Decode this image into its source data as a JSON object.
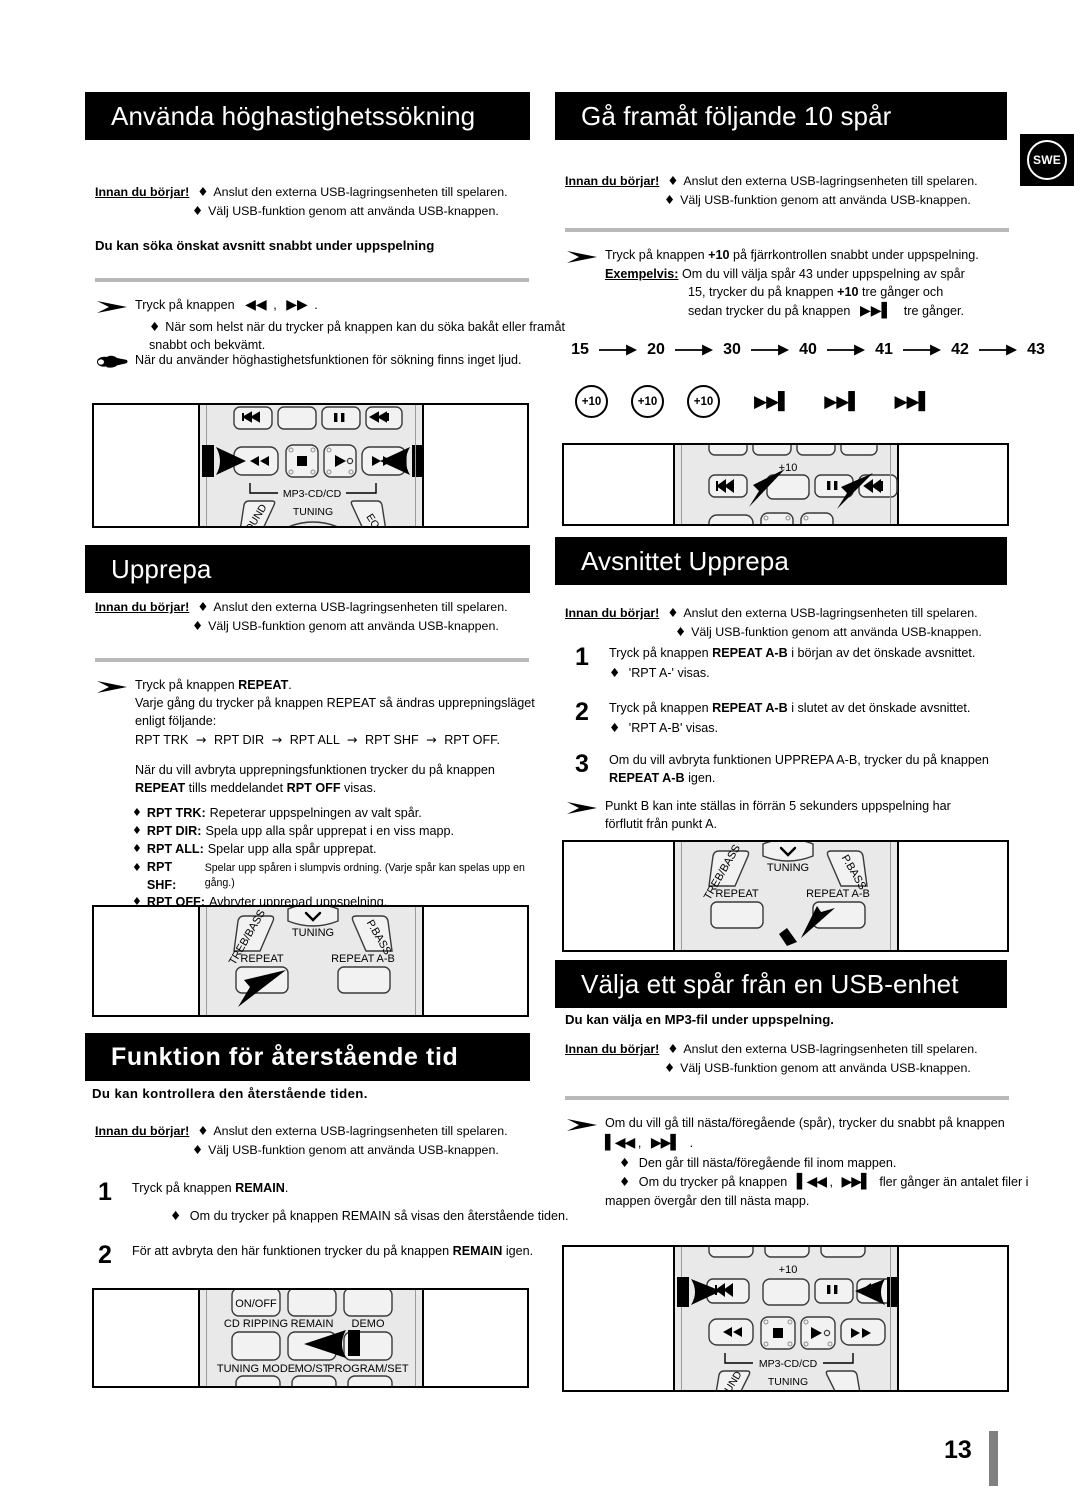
{
  "page": {
    "number": "13",
    "language_badge": "SWE"
  },
  "common": {
    "innan_label": "Innan du börjar!",
    "innan_line1": "Anslut den externa USB-lagringsenheten till spelaren.",
    "innan_line2": "Välj USB-funktion genom att använda USB-knappen.",
    "diamond": "♦",
    "arrow": "→"
  },
  "sections": {
    "hogastighetssokning": {
      "title": "Använda höghastighetssökning",
      "subtitle": "Du kan söka önskat avsnitt snabbt under uppspelning",
      "instruction_pre": "Tryck på knappen",
      "instruction_mid": ",",
      "instruction_post": ".",
      "bullet1": "När som helst när du trycker på knappen kan du söka bakåt eller framåt snabbt och bekvämt.",
      "note": "När du använder höghastighetsfunktionen för sökning finns inget ljud.",
      "remote": {
        "label_mp3": "MP3-CD/CD",
        "label_tuning": "TUNING",
        "label_sound": "SOUND",
        "label_eq": "EQ"
      }
    },
    "ga_framat": {
      "title": "Gå framåt följande 10 spår",
      "instruction": "Tryck på knappen +10 på fjärrkontrollen snabbt under uppspelning.",
      "instruction_btn": "+10",
      "instruction_a": "Tryck på knappen",
      "instruction_b": "på fjärrkontrollen snabbt under uppspelning.",
      "example_label": "Exempelvis:",
      "example_l1": "Om du vill välja spår 43 under uppspelning av spår",
      "example_l2a": "15, trycker du på knappen",
      "example_l2b": "+10",
      "example_l2c": "tre gånger och",
      "example_l3a": "sedan trycker du på knappen",
      "example_l3c": "tre gånger.",
      "sequence": [
        "15",
        "20",
        "30",
        "40",
        "41",
        "42",
        "43"
      ],
      "buttons": [
        "+10",
        "+10",
        "+10",
        "skip-next",
        "skip-next",
        "skip-next"
      ],
      "plus_ten": "+10",
      "remote": {
        "label_plus10": "+10"
      }
    },
    "upprepa": {
      "title": "Upprepa",
      "instruction_a": "Tryck på knappen",
      "instruction_btn": "REPEAT",
      "instruction_post": ".",
      "body_l1": "Varje gång du trycker på knappen REPEAT så ändras upprepningsläget",
      "body_l2": "enligt följande:",
      "cycle": [
        "RPT TRK",
        "RPT DIR",
        "RPT ALL",
        "RPT SHF",
        "RPT OFF."
      ],
      "cancel_l1": "När du vill avbryta upprepningsfunktionen trycker du på knappen",
      "cancel_l2a": "REPEAT",
      "cancel_l2b": "tills meddelandet",
      "cancel_l2c": "RPT OFF",
      "cancel_l2d": "visas.",
      "modes": [
        {
          "name": "RPT TRK:",
          "desc": "Repeterar uppspelningen av valt spår.",
          "small": false
        },
        {
          "name": "RPT DIR:",
          "desc": "Spela upp alla spår upprepat i en viss mapp.",
          "small": false
        },
        {
          "name": "RPT ALL:",
          "desc": "Spelar upp alla spår upprepat.",
          "small": false
        },
        {
          "name": "RPT SHF:",
          "desc": "Spelar upp spåren i slumpvis ordning. (Varje spår kan spelas upp en gång.)",
          "small": true
        },
        {
          "name": "RPT OFF:",
          "desc": "Avbryter upprepad uppspelning.",
          "small": false
        }
      ],
      "remote": {
        "treb_bass": "TREB/BASS",
        "tuning": "TUNING",
        "pbass": "P.BASS",
        "repeat": "REPEAT",
        "repeat_ab": "REPEAT A-B"
      }
    },
    "avsnittet_upprepa": {
      "title": "Avsnittet Upprepa",
      "steps": [
        {
          "num": "1",
          "line_a": "Tryck på knappen",
          "btn": "REPEAT A-B",
          "line_b": "i början av det önskade avsnittet.",
          "bullet": "'RPT A-' visas."
        },
        {
          "num": "2",
          "line_a": "Tryck på knappen",
          "btn": "REPEAT A-B",
          "line_b": "i slutet av det önskade avsnittet.",
          "bullet": "'RPT A-B' visas."
        },
        {
          "num": "3",
          "line_a": "Om du vill avbryta funktionen UPPREPA A-B, trycker du på knappen",
          "btn": "REPEAT A-B",
          "line_b": "igen.",
          "bullet": ""
        }
      ],
      "note_l1": "Punkt B kan inte ställas in förrän 5 sekunders uppspelning har",
      "note_l2": "förflutit från punkt A.",
      "remote": {
        "treb_bass": "TREB/BASS",
        "tuning": "TUNING",
        "pbass": "P.BASS",
        "repeat": "REPEAT",
        "repeat_ab": "REPEAT A-B"
      }
    },
    "aterstaende_tid": {
      "title": "Funktion för återstående tid",
      "subtitle": "Du kan kontrollera den återstående tiden.",
      "steps": [
        {
          "num": "1",
          "line_a": "Tryck på knappen",
          "btn": "REMAIN",
          "line_b": ".",
          "bullet": "Om du trycker på knappen REMAIN så visas den återstående tiden."
        },
        {
          "num": "2",
          "line_a": "För att avbryta den här funktionen trycker du på knappen",
          "btn": "REMAIN",
          "line_b": "igen.",
          "bullet": ""
        }
      ],
      "remote": {
        "onoff": "ON/OFF",
        "cd_ripping": "CD RIPPING",
        "remain": "REMAIN",
        "demo": "DEMO",
        "tuning_mode": "TUNING MODE",
        "most": "MO/ST",
        "program_set": "PROGRAM/SET"
      }
    },
    "valja_spar_usb": {
      "title": "Välja ett spår från en USB-enhet",
      "subtitle": "Du kan välja en MP3-fil under uppspelning.",
      "instruction_l1": "Om du vill gå till nästa/föregående (spår), trycker du snabbt på knappen",
      "instruction_l2_sep": ",",
      "instruction_l2_end": ".",
      "bullet1": "Den går till nästa/föregående fil inom mappen.",
      "bullet2_a": "Om du trycker på knappen",
      "bullet2_sep": ",",
      "bullet2_b": "fler gånger än antalet filer i",
      "bullet2_c": "mappen övergår den till nästa mapp.",
      "remote": {
        "label_plus10": "+10",
        "label_mp3": "MP3-CD/CD",
        "label_tuning": "TUNING",
        "label_sound": "SOUND"
      }
    }
  }
}
